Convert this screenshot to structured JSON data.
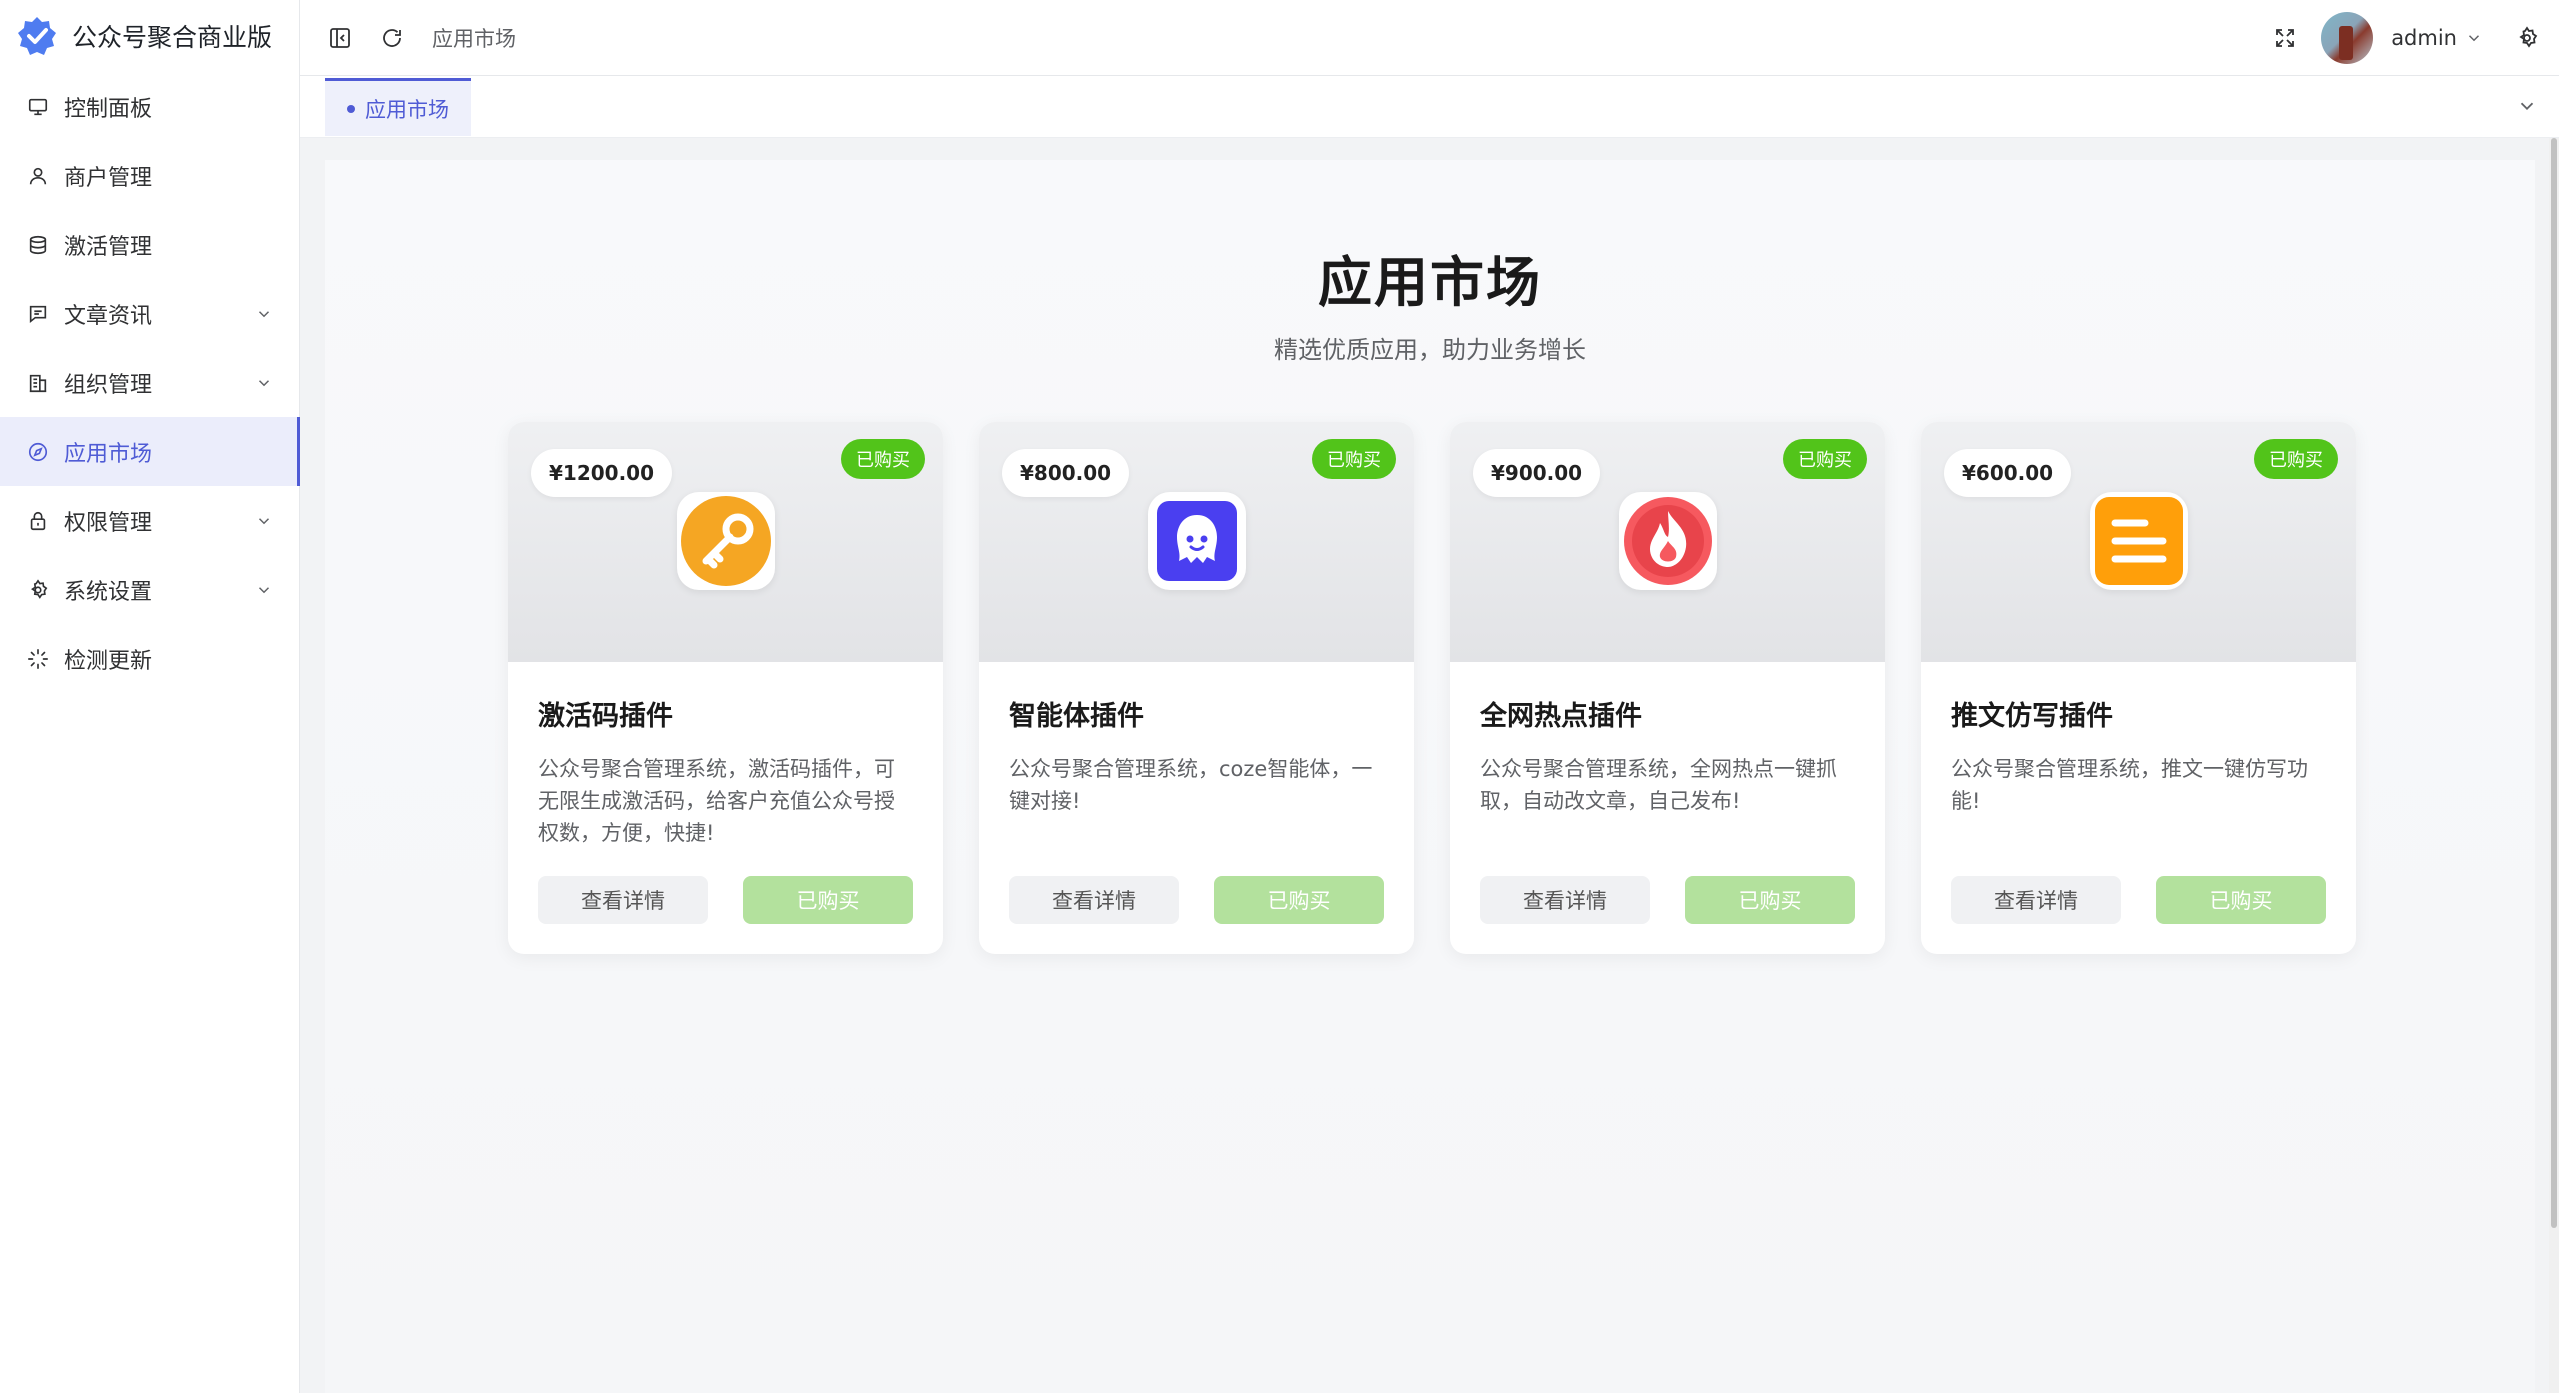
{
  "brand": {
    "title": "公众号聚合商业版",
    "accent": "#4f5bd5"
  },
  "sidebar": {
    "items": [
      {
        "label": "控制面板",
        "icon": "monitor-icon",
        "has_children": false
      },
      {
        "label": "商户管理",
        "icon": "user-icon",
        "has_children": false
      },
      {
        "label": "激活管理",
        "icon": "database-icon",
        "has_children": false
      },
      {
        "label": "文章资讯",
        "icon": "message-icon",
        "has_children": true
      },
      {
        "label": "组织管理",
        "icon": "building-icon",
        "has_children": true
      },
      {
        "label": "应用市场",
        "icon": "compass-icon",
        "has_children": false,
        "active": true
      },
      {
        "label": "权限管理",
        "icon": "lock-icon",
        "has_children": true
      },
      {
        "label": "系统设置",
        "icon": "gear-icon",
        "has_children": true
      },
      {
        "label": "检测更新",
        "icon": "loading-icon",
        "has_children": false
      }
    ]
  },
  "header": {
    "breadcrumb": "应用市场",
    "user_name": "admin"
  },
  "tabs": [
    {
      "label": "应用市场",
      "active": true
    }
  ],
  "market": {
    "title": "应用市场",
    "subtitle": "精选优质应用，助力业务增长",
    "detail_label": "查看详情",
    "bought_label": "已购买",
    "badge_label": "已购买",
    "cards": [
      {
        "price": "¥1200.00",
        "title": "激活码插件",
        "desc": "公众号聚合管理系统，激活码插件，可无限生成激活码，给客户充值公众号授权数，方便，快捷!",
        "icon": "key-icon",
        "icon_color": "#f5a623"
      },
      {
        "price": "¥800.00",
        "title": "智能体插件",
        "desc": "公众号聚合管理系统，coze智能体，一键对接!",
        "icon": "robot-icon",
        "icon_color": "#4a3ff0"
      },
      {
        "price": "¥900.00",
        "title": "全网热点插件",
        "desc": "公众号聚合管理系统，全网热点一键抓取，自动改文章，自己发布!",
        "icon": "fire-icon",
        "icon_color": "#ef4a52"
      },
      {
        "price": "¥600.00",
        "title": "推文仿写插件",
        "desc": "公众号聚合管理系统，推文一键仿写功能!",
        "icon": "document-icon",
        "icon_color": "#ff9f0a"
      }
    ]
  }
}
